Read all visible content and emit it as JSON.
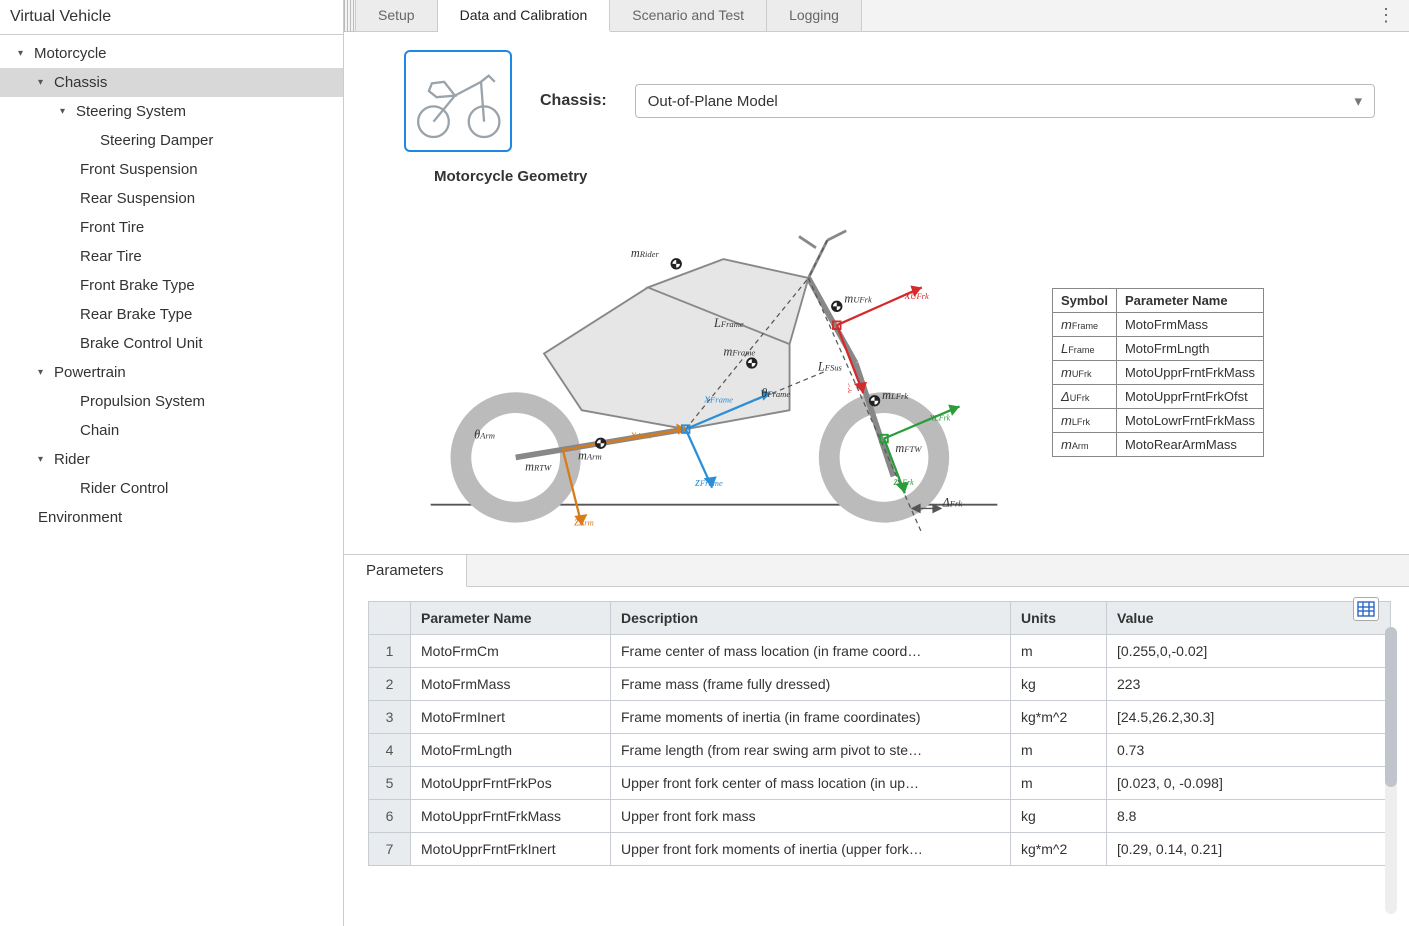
{
  "sidebar": {
    "title": "Virtual Vehicle",
    "tree": [
      {
        "label": "Motorcycle",
        "level": 0,
        "caret": true
      },
      {
        "label": "Chassis",
        "level": 1,
        "caret": true,
        "selected": true
      },
      {
        "label": "Steering System",
        "level": 2,
        "caret": true
      },
      {
        "label": "Steering Damper",
        "level": 3,
        "caret": false
      },
      {
        "label": "Front Suspension",
        "level": 2,
        "caret": false,
        "nocaret": true
      },
      {
        "label": "Rear Suspension",
        "level": 2,
        "caret": false,
        "nocaret": true
      },
      {
        "label": "Front Tire",
        "level": 2,
        "caret": false,
        "nocaret": true
      },
      {
        "label": "Rear Tire",
        "level": 2,
        "caret": false,
        "nocaret": true
      },
      {
        "label": "Front Brake Type",
        "level": 2,
        "caret": false,
        "nocaret": true
      },
      {
        "label": "Rear Brake Type",
        "level": 2,
        "caret": false,
        "nocaret": true
      },
      {
        "label": "Brake Control Unit",
        "level": 2,
        "caret": false,
        "nocaret": true
      },
      {
        "label": "Powertrain",
        "level": 1,
        "caret": true
      },
      {
        "label": "Propulsion System",
        "level": 2,
        "caret": false,
        "nocaret": true
      },
      {
        "label": "Chain",
        "level": 2,
        "caret": false,
        "nocaret": true
      },
      {
        "label": "Rider",
        "level": 1,
        "caret": true
      },
      {
        "label": "Rider Control",
        "level": 2,
        "caret": false,
        "nocaret": true
      },
      {
        "label": "Environment",
        "level": 1,
        "caret": false
      }
    ]
  },
  "tabs": [
    "Setup",
    "Data and Calibration",
    "Scenario and Test",
    "Logging"
  ],
  "activeTab": 1,
  "chassis": {
    "label": "Chassis:",
    "value": "Out-of-Plane Model"
  },
  "diagram": {
    "title": "Motorcycle Geometry",
    "labels": {
      "m_rider": "m",
      "m_rider_sub": "Rider",
      "m_ufrk": "m",
      "m_ufrk_sub": "UFrk",
      "x_ufrk": "x",
      "x_ufrk_sub": "UFrk",
      "l_frame": "L",
      "l_frame_sub": "Frame",
      "m_frame": "m",
      "m_frame_sub": "Frame",
      "x_frame": "x",
      "x_frame_sub": "Frame",
      "th_frame": "θ",
      "th_frame_sub": "Frame",
      "l_fsus": "L",
      "l_fsus_sub": "FSus",
      "z_ufrk": "z",
      "z_ufrk_sub": "UFrk",
      "m_lfrk": "m",
      "m_lfrk_sub": "LFrk",
      "x_lfrk": "x",
      "x_lfrk_sub": "LFrk",
      "m_ftw": "m",
      "m_ftw_sub": "FTW",
      "z_lfrk": "z",
      "z_lfrk_sub": "LFrk",
      "d_frk": "Δ",
      "d_frk_sub": "Frk",
      "th_arm": "θ",
      "th_arm_sub": "Arm",
      "m_rtw": "m",
      "m_rtw_sub": "RTW",
      "m_arm": "m",
      "m_arm_sub": "Arm",
      "x_arm": "x",
      "x_arm_sub": "Arm",
      "z_arm": "z",
      "z_arm_sub": "Arm",
      "z_frame": "z",
      "z_frame_sub": "Frame"
    }
  },
  "legend": {
    "headers": [
      "Symbol",
      "Parameter Name"
    ],
    "rows": [
      {
        "sym": "m",
        "sub": "Frame",
        "name": "MotoFrmMass"
      },
      {
        "sym": "L",
        "sub": "Frame",
        "name": "MotoFrmLngth"
      },
      {
        "sym": "m",
        "sub": "UFrk",
        "name": "MotoUpprFrntFrkMass"
      },
      {
        "sym": "Δ",
        "sub": "UFrk",
        "name": "MotoUpprFrntFrkOfst"
      },
      {
        "sym": "m",
        "sub": "LFrk",
        "name": "MotoLowrFrntFrkMass"
      },
      {
        "sym": "m",
        "sub": "Arm",
        "name": "MotoRearArmMass"
      }
    ]
  },
  "paramsTab": "Parameters",
  "paramTable": {
    "headers": [
      "Parameter Name",
      "Description",
      "Units",
      "Value"
    ],
    "rows": [
      {
        "n": 1,
        "name": "MotoFrmCm",
        "desc": "Frame center of mass location (in frame coord…",
        "units": "m",
        "value": "[0.255,0,-0.02]"
      },
      {
        "n": 2,
        "name": "MotoFrmMass",
        "desc": "Frame mass (frame fully dressed)",
        "units": "kg",
        "value": "223"
      },
      {
        "n": 3,
        "name": "MotoFrmInert",
        "desc": "Frame moments of inertia (in frame coordinates)",
        "units": "kg*m^2",
        "value": "[24.5,26.2,30.3]"
      },
      {
        "n": 4,
        "name": "MotoFrmLngth",
        "desc": "Frame length (from rear swing arm pivot to ste…",
        "units": "m",
        "value": "0.73"
      },
      {
        "n": 5,
        "name": "MotoUpprFrntFrkPos",
        "desc": "Upper front fork center of mass location (in up…",
        "units": "m",
        "value": "[0.023, 0, -0.098]"
      },
      {
        "n": 6,
        "name": "MotoUpprFrntFrkMass",
        "desc": "Upper front fork mass",
        "units": "kg",
        "value": "8.8"
      },
      {
        "n": 7,
        "name": "MotoUpprFrntFrkInert",
        "desc": "Upper front fork moments of inertia (upper fork…",
        "units": "kg*m^2",
        "value": "[0.29, 0.14, 0.21]"
      }
    ]
  }
}
